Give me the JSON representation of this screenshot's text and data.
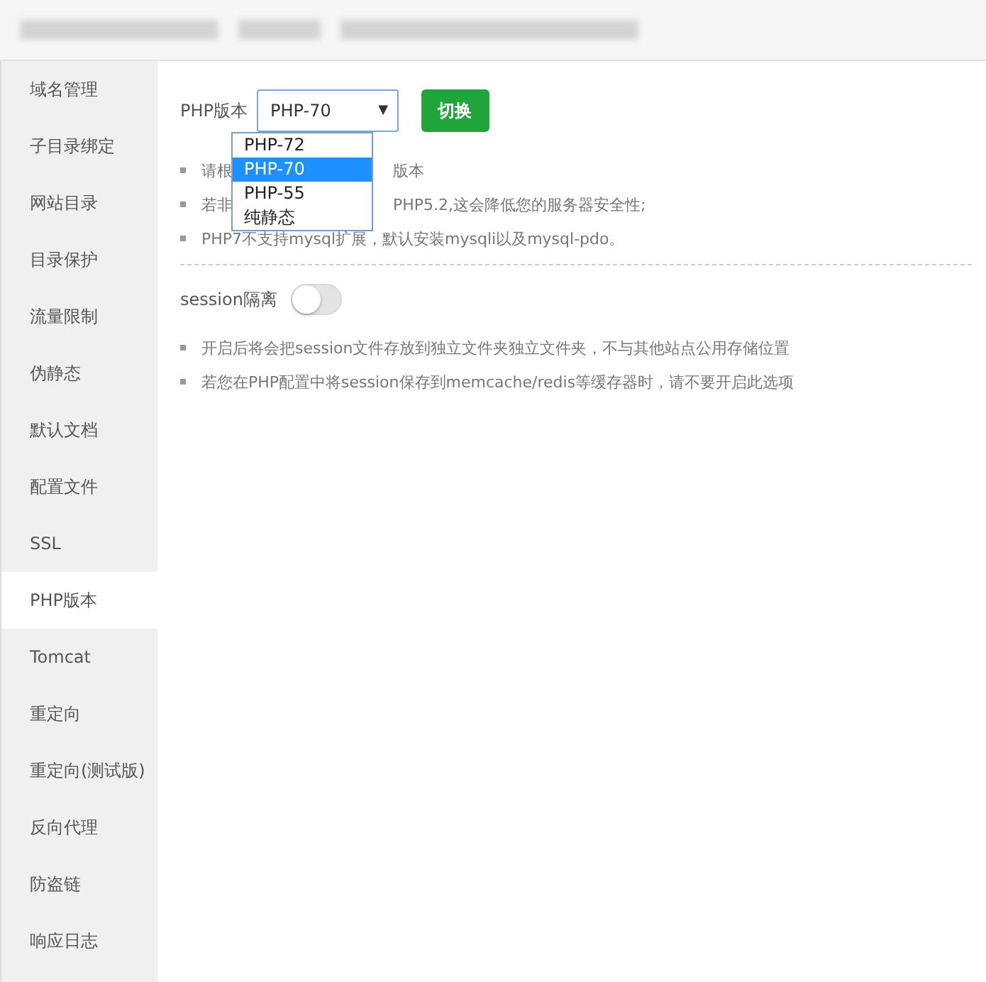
{
  "sidebar": {
    "items": [
      {
        "label": "域名管理",
        "selected": false
      },
      {
        "label": "子目录绑定",
        "selected": false
      },
      {
        "label": "网站目录",
        "selected": false
      },
      {
        "label": "目录保护",
        "selected": false
      },
      {
        "label": "流量限制",
        "selected": false
      },
      {
        "label": "伪静态",
        "selected": false
      },
      {
        "label": "默认文档",
        "selected": false
      },
      {
        "label": "配置文件",
        "selected": false
      },
      {
        "label": "SSL",
        "selected": false
      },
      {
        "label": "PHP版本",
        "selected": true
      },
      {
        "label": "Tomcat",
        "selected": false
      },
      {
        "label": "重定向",
        "selected": false
      },
      {
        "label": "重定向(测试版)",
        "selected": false
      },
      {
        "label": "反向代理",
        "selected": false
      },
      {
        "label": "防盗链",
        "selected": false
      },
      {
        "label": "响应日志",
        "selected": false
      }
    ]
  },
  "php": {
    "label": "PHP版本",
    "select": {
      "value": "PHP-70",
      "caret": "▼",
      "options": [
        {
          "label": "PHP-72",
          "selected": false
        },
        {
          "label": "PHP-70",
          "selected": true
        },
        {
          "label": "PHP-55",
          "selected": false
        },
        {
          "label": "纯静态",
          "selected": false
        }
      ]
    },
    "button": "切换",
    "notes": [
      {
        "before": "请根",
        "after": "版本"
      },
      {
        "before": "若非",
        "after": "PHP5.2,这会降低您的服务器安全性;"
      },
      {
        "before": "PHP7不支持mysql扩展，默认安装mysqli以及mysql-pdo。"
      }
    ]
  },
  "session": {
    "label": "session隔离",
    "on": false,
    "notes": [
      "开启后将会把session文件存放到独立文件夹独立文件夹，不与其他站点公用存储位置",
      "若您在PHP配置中将session保存到memcache/redis等缓存器时，请不要开启此选项"
    ]
  }
}
